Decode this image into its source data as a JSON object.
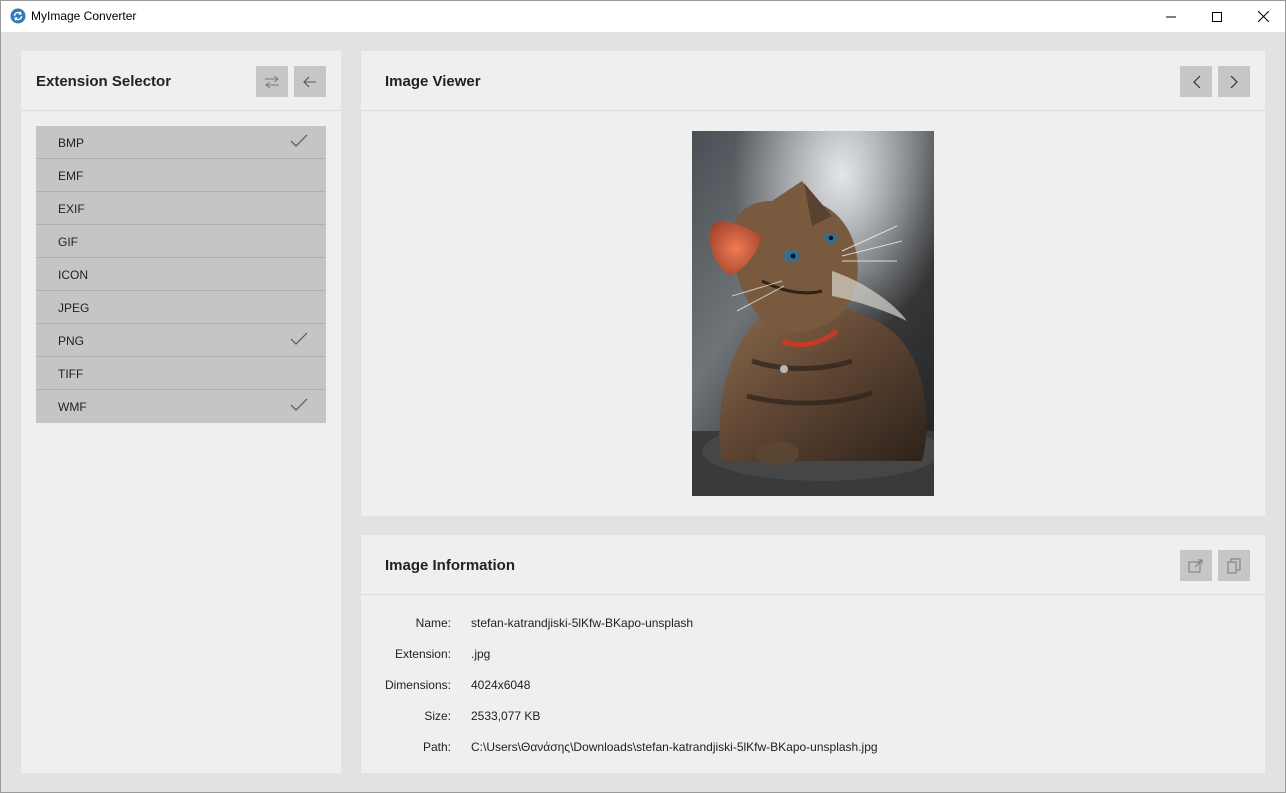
{
  "window": {
    "title": "MyImage Converter"
  },
  "extension_selector": {
    "title": "Extension Selector",
    "items": [
      {
        "label": "BMP",
        "checked": true
      },
      {
        "label": "EMF",
        "checked": false
      },
      {
        "label": "EXIF",
        "checked": false
      },
      {
        "label": "GIF",
        "checked": false
      },
      {
        "label": "ICON",
        "checked": false
      },
      {
        "label": "JPEG",
        "checked": false
      },
      {
        "label": "PNG",
        "checked": true
      },
      {
        "label": "TIFF",
        "checked": false
      },
      {
        "label": "WMF",
        "checked": true
      }
    ]
  },
  "image_viewer": {
    "title": "Image Viewer"
  },
  "image_information": {
    "title": "Image Information",
    "rows": [
      {
        "key": "Name:",
        "value": "stefan-katrandjiski-5lKfw-BKapo-unsplash"
      },
      {
        "key": "Extension:",
        "value": ".jpg"
      },
      {
        "key": "Dimensions:",
        "value": "4024x6048"
      },
      {
        "key": "Size:",
        "value": "2533,077 KB"
      },
      {
        "key": "Path:",
        "value": "C:\\Users\\Θανάσης\\Downloads\\stefan-katrandjiski-5lKfw-BKapo-unsplash.jpg"
      }
    ]
  },
  "colors": {
    "accent": "#1e6fa8",
    "panel_bg": "#efefef",
    "button_bg": "#c6c6c6",
    "list_item_bg": "#c5c5c5"
  }
}
